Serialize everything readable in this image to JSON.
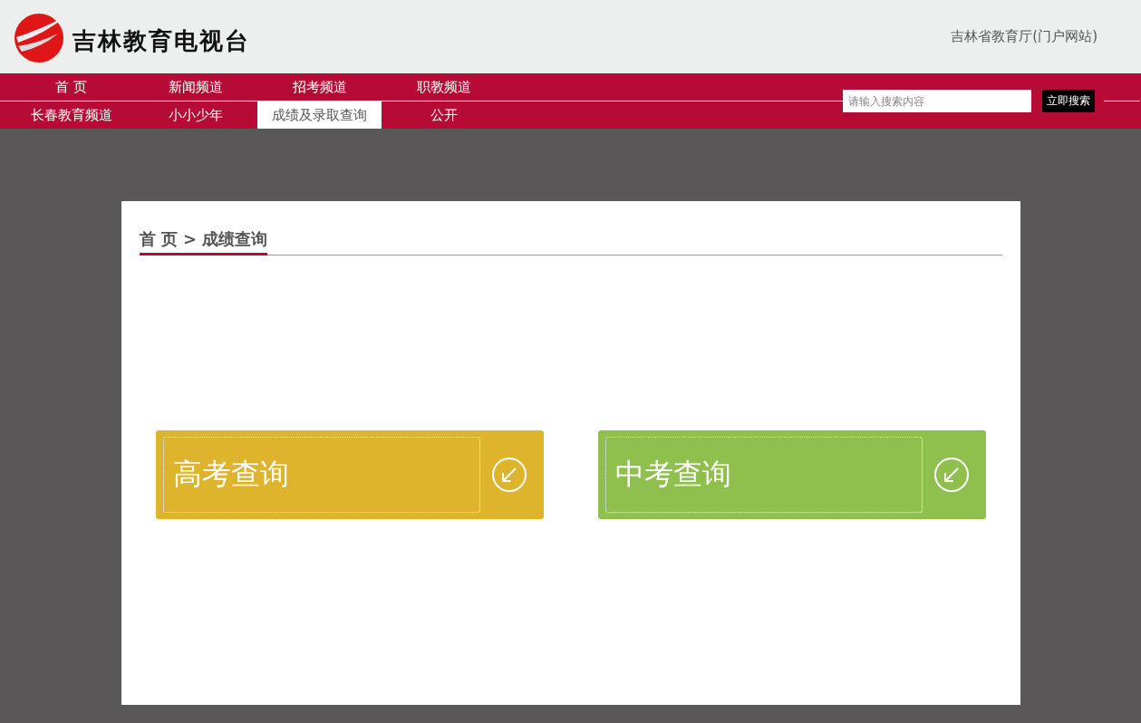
{
  "header": {
    "logo_text": "吉林教育电视台",
    "portal_link": "吉林省教育厅(门户网站)"
  },
  "nav_rows": [
    [
      {
        "label": "首 页",
        "selected": false
      },
      {
        "label": "新闻频道",
        "selected": false
      },
      {
        "label": "招考频道",
        "selected": false
      },
      {
        "label": "职教频道",
        "selected": false
      }
    ],
    [
      {
        "label": "长春教育频道",
        "selected": false
      },
      {
        "label": "小小少年",
        "selected": false
      },
      {
        "label": "成绩及录取查询",
        "selected": true
      },
      {
        "label": "公开",
        "selected": false
      }
    ]
  ],
  "search": {
    "placeholder": "请输入搜索内容",
    "button": "立即搜索"
  },
  "breadcrumb": "首 页 > 成绩查询",
  "cards": [
    {
      "label": "高考查询",
      "color": "#ddb42b"
    },
    {
      "label": "中考查询",
      "color": "#8fc04e"
    }
  ]
}
